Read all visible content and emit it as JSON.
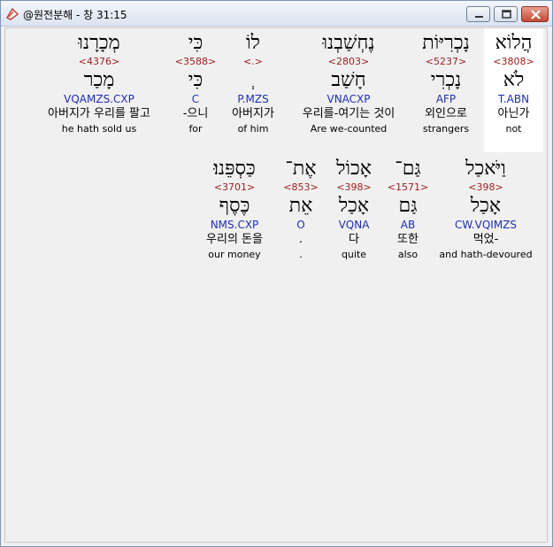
{
  "window": {
    "title": "@원전분해 - 창 31:15"
  },
  "words": [
    {
      "hebrew": "הֲלוֹא",
      "strong": "<3808>",
      "lexeme": "לֹא",
      "morph": "T.ABN",
      "korean": "아닌가",
      "english": "not"
    },
    {
      "hebrew": "נָכְרִיּוֹת",
      "strong": "<5237>",
      "lexeme": "נָכְרִי",
      "morph": "AFP",
      "korean": "외인으로",
      "english": "strangers"
    },
    {
      "hebrew": "נֶחְשַׁבְנוּ",
      "strong": "<2803>",
      "lexeme": "חָשַׁב",
      "morph": "VNACXP",
      "korean": "우리를-여기는 것이",
      "english": "Are we-counted"
    },
    {
      "hebrew": "לוֹ",
      "strong": "<.>",
      "lexeme": "ְ",
      "morph": "P.MZS",
      "korean": "아버지가",
      "english": "of him"
    },
    {
      "hebrew": "כִּי",
      "strong": "<3588>",
      "lexeme": "כִּי",
      "morph": "C",
      "korean": "-으니",
      "english": "for"
    },
    {
      "hebrew": "מְכָרָנוּ",
      "strong": "<4376>",
      "lexeme": "מָכַר",
      "morph": "VQAMZS.CXP",
      "korean": "아버지가 우리를 팔고",
      "english": "he hath sold us"
    },
    {
      "hebrew": "וַיֹּאכַל",
      "strong": "<398>",
      "lexeme": "אָכַל",
      "morph": "CW.VQIMZS",
      "korean": "먹었-",
      "english": "and hath-devoured"
    },
    {
      "hebrew": "גַּם־",
      "strong": "<1571>",
      "lexeme": "גַּם",
      "morph": "AB",
      "korean": "또한",
      "english": "also"
    },
    {
      "hebrew": "אָכוֹל",
      "strong": "<398>",
      "lexeme": "אָכַל",
      "morph": "VQNA",
      "korean": "다",
      "english": "quite"
    },
    {
      "hebrew": "אֶת־",
      "strong": "<853>",
      "lexeme": "אֵת",
      "morph": "O",
      "korean": ".",
      "english": "."
    },
    {
      "hebrew": "כַּסְפֵּנוּ׃",
      "strong": "<3701>",
      "lexeme": "כֶּסֶף",
      "morph": "NMS.CXP",
      "korean": "우리의 돈을",
      "english": "our money"
    }
  ]
}
